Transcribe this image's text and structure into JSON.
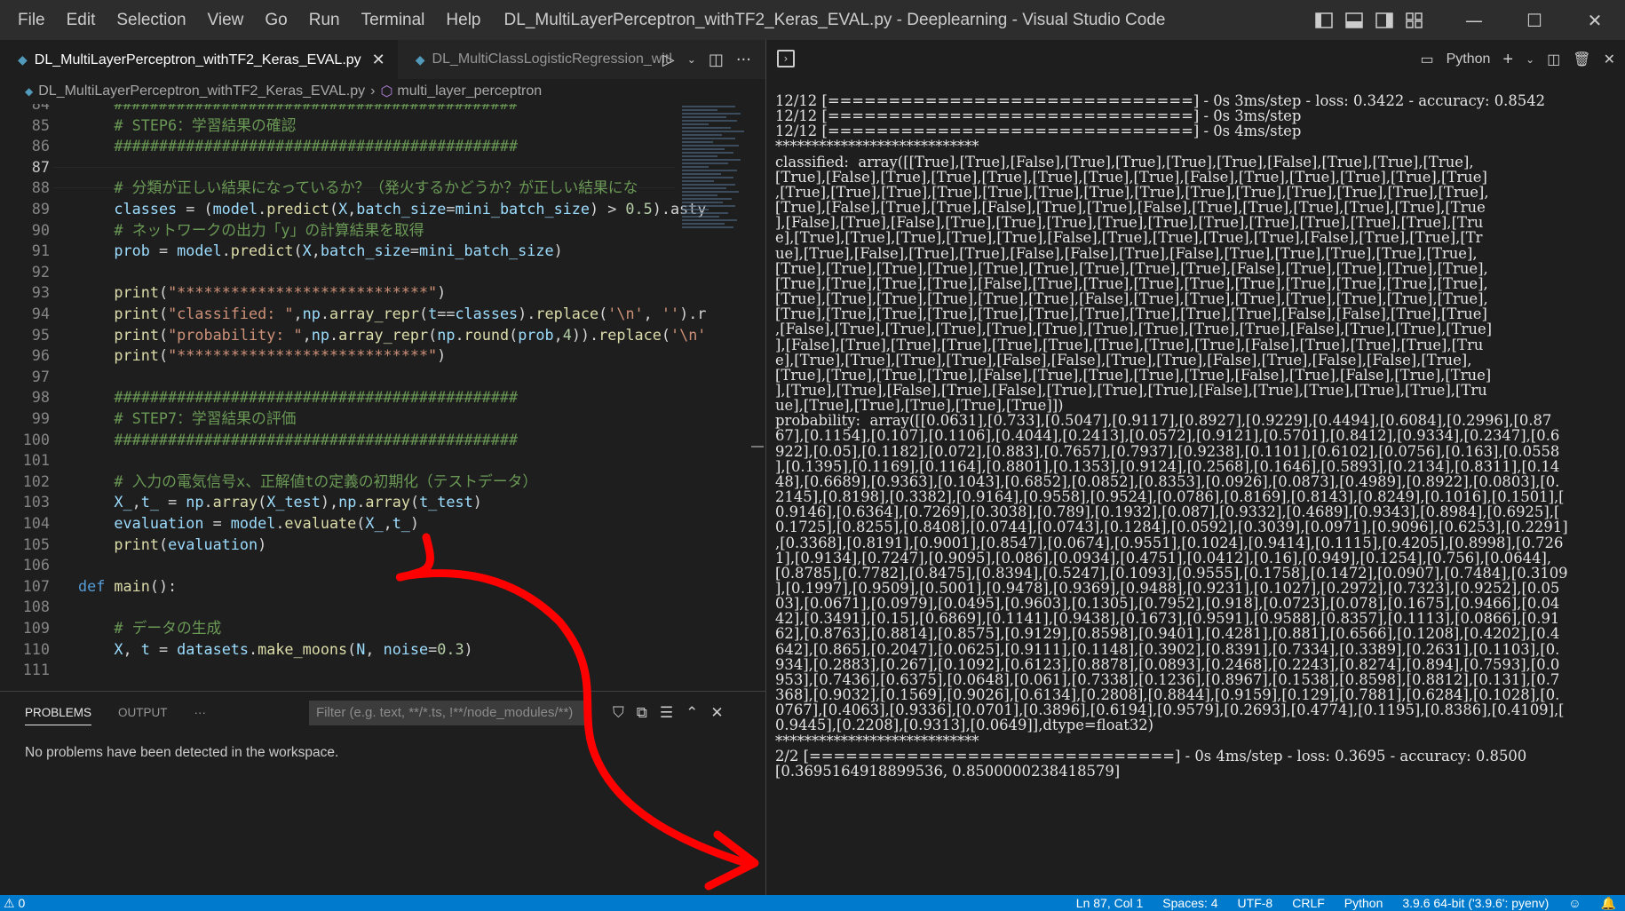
{
  "menu": [
    "File",
    "Edit",
    "Selection",
    "View",
    "Go",
    "Run",
    "Terminal",
    "Help"
  ],
  "window_title": "DL_MultiLayerPerceptron_withTF2_Keras_EVAL.py - Deeplearning - Visual Studio Code",
  "window_controls": {
    "minimize": "—",
    "maximize": "☐",
    "close": "✕"
  },
  "tabs": [
    {
      "label": "DL_MultiLayerPerceptron_withTF2_Keras_EVAL.py",
      "active": true
    },
    {
      "label": "DL_MultiClassLogisticRegression_witl",
      "active": false
    }
  ],
  "breadcrumb": {
    "file": "DL_MultiLayerPerceptron_withTF2_Keras_EVAL.py",
    "symbol": "multi_layer_perceptron"
  },
  "editor": {
    "current_line": 87,
    "lines": [
      {
        "n": 84,
        "text": "    #############################################"
      },
      {
        "n": 85,
        "text": "    # STEP6：学習結果の確認"
      },
      {
        "n": 86,
        "text": "    #############################################"
      },
      {
        "n": 87,
        "text": ""
      },
      {
        "n": 88,
        "text": "    # 分類が正しい結果になっているか？（発火するかどうか？が正しい結果にな"
      },
      {
        "n": 89,
        "text": "    classes = (model.predict(X,batch_size=mini_batch_size) > 0.5).asty"
      },
      {
        "n": 90,
        "text": "    # ネットワークの出力「y」の計算結果を取得"
      },
      {
        "n": 91,
        "text": "    prob = model.predict(X,batch_size=mini_batch_size)"
      },
      {
        "n": 92,
        "text": ""
      },
      {
        "n": 93,
        "text": "    print(\"****************************\")"
      },
      {
        "n": 94,
        "text": "    print(\"classified: \",np.array_repr(t==classes).replace('\\n', '').r"
      },
      {
        "n": 95,
        "text": "    print(\"probability: \",np.array_repr(np.round(prob,4)).replace('\\n'"
      },
      {
        "n": 96,
        "text": "    print(\"****************************\")"
      },
      {
        "n": 97,
        "text": ""
      },
      {
        "n": 98,
        "text": "    #############################################"
      },
      {
        "n": 99,
        "text": "    # STEP7：学習結果の評価"
      },
      {
        "n": 100,
        "text": "    #############################################"
      },
      {
        "n": 101,
        "text": ""
      },
      {
        "n": 102,
        "text": "    # 入力の電気信号x、正解値tの定義の初期化（テストデータ）"
      },
      {
        "n": 103,
        "text": "    X_,t_ = np.array(X_test),np.array(t_test)"
      },
      {
        "n": 104,
        "text": "    evaluation = model.evaluate(X_,t_)"
      },
      {
        "n": 105,
        "text": "    print(evaluation)"
      },
      {
        "n": 106,
        "text": ""
      },
      {
        "n": 107,
        "text": "def main():"
      },
      {
        "n": 108,
        "text": ""
      },
      {
        "n": 109,
        "text": "    # データの生成"
      },
      {
        "n": 110,
        "text": "    X, t = datasets.make_moons(N, noise=0.3)"
      },
      {
        "n": 111,
        "text": ""
      }
    ]
  },
  "panel": {
    "tabs": [
      "PROBLEMS",
      "OUTPUT",
      "···"
    ],
    "filter_placeholder": "Filter (e.g. text, **/*.ts, !**/node_modules/**)",
    "message": "No problems have been detected in the workspace."
  },
  "terminal": {
    "shell_label": "Python",
    "lines": [
      "12/12 [==============================] - 0s 3ms/step - loss: 0.3422 - accuracy: 0.8542",
      "12/12 [==============================] - 0s 3ms/step",
      "12/12 [==============================] - 0s 4ms/step",
      "****************************",
      "classified:  array([[True],[True],[False],[True],[True],[True],[True],[False],[True],[True],[True],",
      "[True],[False],[True],[True],[True],[True],[True],[True],[False],[True],[True],[True],[True],[True]",
      ",[True],[True],[True],[True],[True],[True],[True],[True],[True],[True],[True],[True],[True],[True],",
      "[True],[False],[True],[True],[False],[True],[True],[False],[True],[True],[True],[True],[True],[True",
      "],[False],[True],[False],[True],[True],[True],[True],[True],[True],[True],[True],[True],[True],[Tru",
      "e],[True],[True],[True],[True],[True],[False],[True],[True],[True],[True],[False],[True],[True],[Tr",
      "ue],[True],[False],[True],[True],[False],[False],[True],[False],[True],[True],[True],[True],[True],",
      "[True],[True],[True],[True],[True],[True],[True],[True],[True],[False],[True],[True],[True],[True],",
      "[True],[True],[True],[True],[False],[True],[True],[True],[True],[True],[True],[True],[True],[True],",
      "[True],[True],[True],[True],[True],[True],[False],[True],[True],[True],[True],[True],[True],[True],",
      "[True],[True],[True],[True],[True],[True],[True],[True],[True],[True],[False],[False],[True],[True]",
      ",[False],[True],[True],[True],[True],[True],[True],[True],[True],[True],[False],[True],[True],[True]",
      "],[False],[True],[True],[True],[True],[True],[True],[True],[True],[False],[True],[True],[True],[Tru",
      "e],[True],[True],[True],[True],[False],[False],[True],[True],[False],[True],[False],[False],[True],",
      "[True],[True],[True],[True],[False],[True],[True],[True],[True],[False],[True],[False],[True],[True]",
      "],[True],[True],[False],[True],[False],[True],[True],[True],[False],[True],[True],[True],[True],[Tru",
      "ue],[True],[True],[True],[True],[True]])",
      "probability:  array([[0.0631],[0.733],[0.5047],[0.9117],[0.8927],[0.9229],[0.4494],[0.6084],[0.2996],[0.87",
      "67],[0.1154],[0.107],[0.1106],[0.4044],[0.2413],[0.0572],[0.9121],[0.5701],[0.8412],[0.9334],[0.2347],[0.6",
      "922],[0.05],[0.1182],[0.072],[0.883],[0.7657],[0.7937],[0.9238],[0.1101],[0.6102],[0.0756],[0.163],[0.0558",
      "],[0.1395],[0.1169],[0.1164],[0.8801],[0.1353],[0.9124],[0.2568],[0.1646],[0.5893],[0.2134],[0.8311],[0.14",
      "48],[0.6689],[0.9363],[0.1043],[0.6852],[0.0852],[0.8353],[0.0926],[0.0873],[0.4989],[0.8922],[0.0803],[0.",
      "2145],[0.8198],[0.3382],[0.9164],[0.9558],[0.9524],[0.0786],[0.8169],[0.8143],[0.8249],[0.1016],[0.1501],[",
      "0.9146],[0.6364],[0.7269],[0.3038],[0.789],[0.1932],[0.087],[0.9332],[0.4689],[0.9343],[0.8984],[0.6925],[",
      "0.1725],[0.8255],[0.8408],[0.0744],[0.0743],[0.1284],[0.0592],[0.3039],[0.0971],[0.9096],[0.6253],[0.2291]",
      ",[0.3368],[0.8191],[0.9001],[0.8547],[0.0674],[0.9551],[0.1024],[0.9414],[0.1115],[0.4205],[0.8998],[0.726",
      "1],[0.9134],[0.7247],[0.9095],[0.086],[0.0934],[0.4751],[0.0412],[0.16],[0.949],[0.1254],[0.756],[0.0644],",
      "[0.8785],[0.7782],[0.8475],[0.8394],[0.5247],[0.1093],[0.9555],[0.1758],[0.1472],[0.0907],[0.7484],[0.3109",
      "],[0.1997],[0.9509],[0.5001],[0.9478],[0.9369],[0.9488],[0.9231],[0.1027],[0.2972],[0.7323],[0.9252],[0.05",
      "03],[0.0671],[0.0979],[0.0495],[0.9603],[0.1305],[0.7952],[0.918],[0.0723],[0.078],[0.1675],[0.9466],[0.04",
      "42],[0.3491],[0.15],[0.6869],[0.1141],[0.9438],[0.1673],[0.9591],[0.9588],[0.8357],[0.1113],[0.0866],[0.91",
      "62],[0.8763],[0.8814],[0.8575],[0.9129],[0.8598],[0.9401],[0.4281],[0.881],[0.6566],[0.1208],[0.4202],[0.4",
      "642],[0.865],[0.2047],[0.0625],[0.9111],[0.1148],[0.3902],[0.8391],[0.7334],[0.3389],[0.2631],[0.1103],[0.",
      "934],[0.2883],[0.267],[0.1092],[0.6123],[0.8878],[0.0893],[0.2468],[0.2243],[0.8274],[0.894],[0.7593],[0.0",
      "953],[0.7436],[0.6375],[0.0648],[0.061],[0.7338],[0.1236],[0.8967],[0.1538],[0.8598],[0.8812],[0.131],[0.7",
      "368],[0.9032],[0.1569],[0.9026],[0.6134],[0.2808],[0.8844],[0.9159],[0.129],[0.7881],[0.6284],[0.1028],[0.",
      "0767],[0.4063],[0.9336],[0.0701],[0.3896],[0.6194],[0.9579],[0.2693],[0.4774],[0.1195],[0.8386],[0.4109],[",
      "0.9445],[0.2208],[0.9313],[0.0649]],dtype=float32)",
      "****************************",
      "2/2 [==============================] - 0s 4ms/step - loss: 0.3695 - accuracy: 0.8500",
      "[0.3695164918899536, 0.8500000238418579]"
    ]
  },
  "statusbar": {
    "left": "⚠ 0",
    "right": [
      "Ln 87, Col 1",
      "Spaces: 4",
      "UTF-8",
      "CRLF",
      "Python",
      "3.9.6 64-bit ('3.9.6': pyenv)"
    ]
  },
  "colors": {
    "accent": "#007acc",
    "annotation": "#ff0000"
  }
}
